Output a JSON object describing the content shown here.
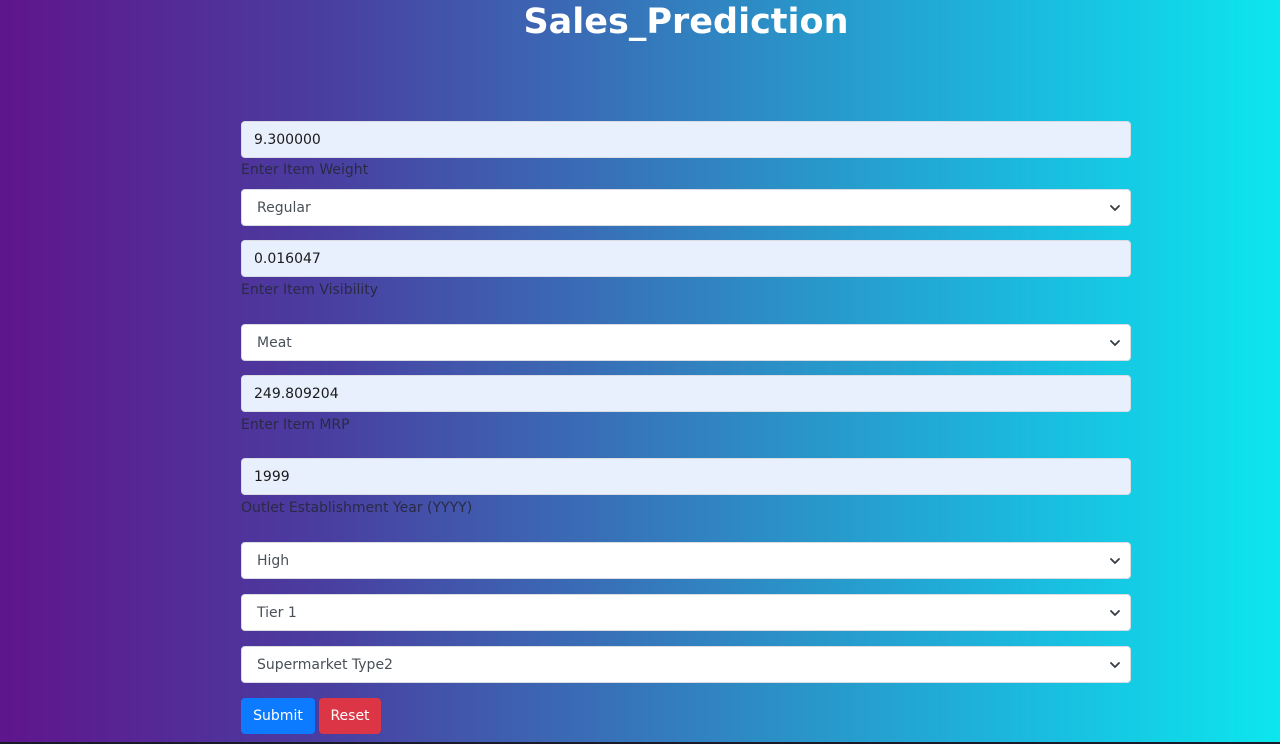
{
  "title": "Sales_Prediction",
  "form": {
    "item_weight": {
      "value": "9.300000",
      "label": "Enter Item Weight"
    },
    "fat_content": {
      "value": "Regular"
    },
    "item_visibility": {
      "value": "0.016047",
      "label": "Enter Item Visibility"
    },
    "item_type": {
      "value": "Meat"
    },
    "item_mrp": {
      "value": "249.809204",
      "label": "Enter Item MRP"
    },
    "establishment_year": {
      "value": "1999",
      "label": "Outlet Establishment Year (YYYY)"
    },
    "outlet_size": {
      "value": "High"
    },
    "location_type": {
      "value": "Tier 1"
    },
    "outlet_type": {
      "value": "Supermarket Type2"
    }
  },
  "buttons": {
    "submit": "Submit",
    "reset": "Reset"
  },
  "colors": {
    "submit_bg": "#0d7bff",
    "reset_bg": "#dc3545",
    "gradient_start": "#5f158c",
    "gradient_end": "#0ce6ee"
  }
}
